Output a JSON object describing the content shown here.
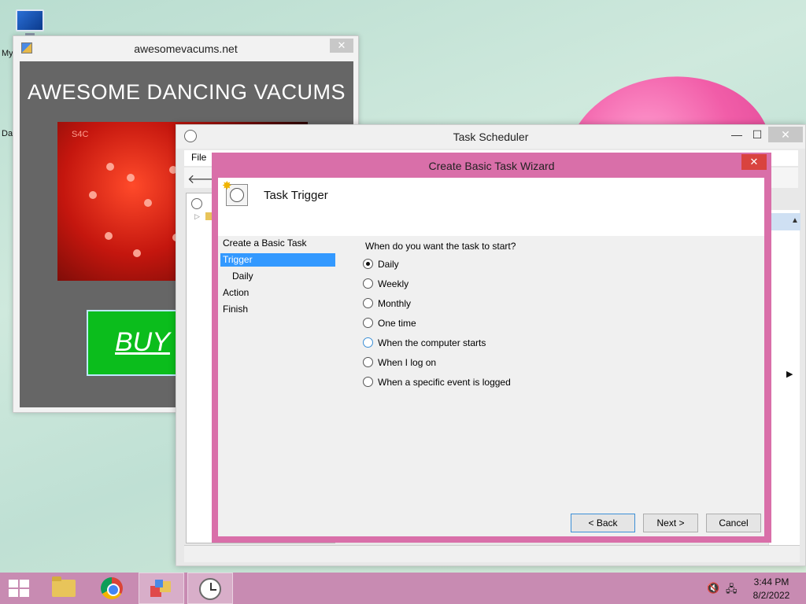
{
  "desktop": {
    "icon_labels": [
      "My",
      "Da"
    ]
  },
  "popup": {
    "title": "awesomevacums.net",
    "headline": "AWESOME DANCING VACUMS",
    "video_text": "S4C",
    "buy_label": "BUY",
    "close_glyph": "✕"
  },
  "task_scheduler": {
    "title": "Task Scheduler",
    "menu": {
      "file": "File"
    },
    "controls": {
      "minimize": "—",
      "maximize": "☐",
      "close": "✕"
    }
  },
  "wizard": {
    "title": "Create Basic Task Wizard",
    "close_glyph": "✕",
    "header_title": "Task Trigger",
    "steps": [
      {
        "label": "Create a Basic Task",
        "active": false,
        "sub": false
      },
      {
        "label": "Trigger",
        "active": true,
        "sub": false
      },
      {
        "label": "Daily",
        "active": false,
        "sub": true
      },
      {
        "label": "Action",
        "active": false,
        "sub": false
      },
      {
        "label": "Finish",
        "active": false,
        "sub": false
      }
    ],
    "question": "When do you want the task to start?",
    "options": [
      {
        "label": "Daily",
        "checked": true
      },
      {
        "label": "Weekly",
        "checked": false
      },
      {
        "label": "Monthly",
        "checked": false
      },
      {
        "label": "One time",
        "checked": false
      },
      {
        "label": "When the computer starts",
        "checked": false
      },
      {
        "label": "When I log on",
        "checked": false
      },
      {
        "label": "When a specific event is logged",
        "checked": false
      }
    ],
    "buttons": {
      "back": "< Back",
      "next": "Next >",
      "cancel": "Cancel"
    }
  },
  "taskbar": {
    "time": "3:44 PM",
    "date": "8/2/2022",
    "items": [
      "windows-start",
      "file-explorer",
      "chrome",
      "app",
      "task-scheduler"
    ]
  },
  "colors": {
    "wizard_frame": "#d96fa9",
    "taskbar": "#c88bb2",
    "selection": "#3399ff",
    "buy_button": "#0bbd1c"
  }
}
